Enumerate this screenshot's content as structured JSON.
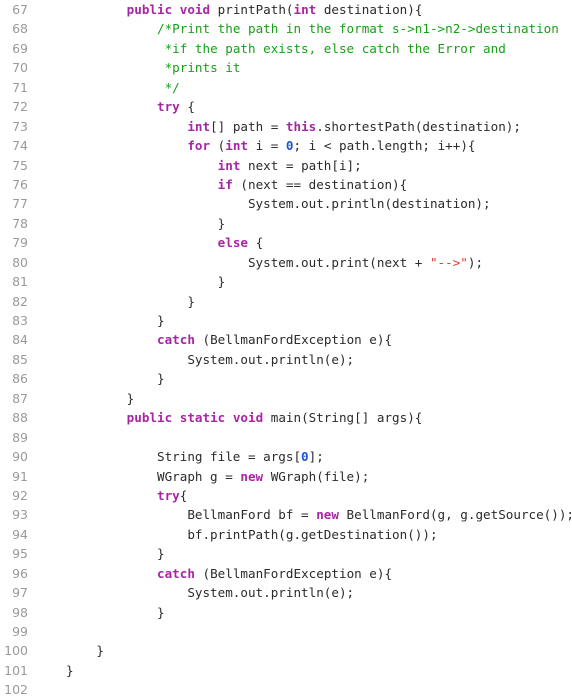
{
  "editor": {
    "language": "Java",
    "first_line_number": 67,
    "last_line_number": 102,
    "colors": {
      "background": "#ffffff",
      "text": "#2b2b2b",
      "gutter": "#9a9a9a",
      "keyword": "#a626a4",
      "comment": "#17a117",
      "string": "#e03c32",
      "number": "#1a54d8"
    }
  },
  "lines": [
    {
      "num": "67",
      "tokens": [
        {
          "t": "        ",
          "c": "pln"
        },
        {
          "t": "public void ",
          "c": "kw"
        },
        {
          "t": "printPath(",
          "c": "pln"
        },
        {
          "t": "int",
          "c": "kw"
        },
        {
          "t": " destination){",
          "c": "pln"
        }
      ]
    },
    {
      "num": "68",
      "tokens": [
        {
          "t": "            ",
          "c": "pln"
        },
        {
          "t": "/*Print the path in the format s->n1->n2->destination",
          "c": "com"
        }
      ]
    },
    {
      "num": "69",
      "tokens": [
        {
          "t": "             ",
          "c": "pln"
        },
        {
          "t": "*if the path exists, else catch the Error and",
          "c": "com"
        }
      ]
    },
    {
      "num": "70",
      "tokens": [
        {
          "t": "             ",
          "c": "pln"
        },
        {
          "t": "*prints it",
          "c": "com"
        }
      ]
    },
    {
      "num": "71",
      "tokens": [
        {
          "t": "             ",
          "c": "pln"
        },
        {
          "t": "*/",
          "c": "com"
        }
      ]
    },
    {
      "num": "72",
      "tokens": [
        {
          "t": "            ",
          "c": "pln"
        },
        {
          "t": "try",
          "c": "kw"
        },
        {
          "t": " {",
          "c": "pln"
        }
      ]
    },
    {
      "num": "73",
      "tokens": [
        {
          "t": "                ",
          "c": "pln"
        },
        {
          "t": "int",
          "c": "kw"
        },
        {
          "t": "[] path = ",
          "c": "pln"
        },
        {
          "t": "this",
          "c": "kw"
        },
        {
          "t": ".shortestPath(destination);",
          "c": "pln"
        }
      ]
    },
    {
      "num": "74",
      "tokens": [
        {
          "t": "                ",
          "c": "pln"
        },
        {
          "t": "for",
          "c": "kw"
        },
        {
          "t": " (",
          "c": "pln"
        },
        {
          "t": "int",
          "c": "kw"
        },
        {
          "t": " i = ",
          "c": "pln"
        },
        {
          "t": "0",
          "c": "num"
        },
        {
          "t": "; i < path.length; i++){",
          "c": "pln"
        }
      ]
    },
    {
      "num": "75",
      "tokens": [
        {
          "t": "                    ",
          "c": "pln"
        },
        {
          "t": "int",
          "c": "kw"
        },
        {
          "t": " next = path[i];",
          "c": "pln"
        }
      ]
    },
    {
      "num": "76",
      "tokens": [
        {
          "t": "                    ",
          "c": "pln"
        },
        {
          "t": "if",
          "c": "kw"
        },
        {
          "t": " (next == destination){",
          "c": "pln"
        }
      ]
    },
    {
      "num": "77",
      "tokens": [
        {
          "t": "                        System.out.println(destination);",
          "c": "pln"
        }
      ]
    },
    {
      "num": "78",
      "tokens": [
        {
          "t": "                    }",
          "c": "pln"
        }
      ]
    },
    {
      "num": "79",
      "tokens": [
        {
          "t": "                    ",
          "c": "pln"
        },
        {
          "t": "else",
          "c": "kw"
        },
        {
          "t": " {",
          "c": "pln"
        }
      ]
    },
    {
      "num": "80",
      "tokens": [
        {
          "t": "                        System.out.print(next + ",
          "c": "pln"
        },
        {
          "t": "\"-->\"",
          "c": "str"
        },
        {
          "t": ");",
          "c": "pln"
        }
      ]
    },
    {
      "num": "81",
      "tokens": [
        {
          "t": "                    }",
          "c": "pln"
        }
      ]
    },
    {
      "num": "82",
      "tokens": [
        {
          "t": "                }",
          "c": "pln"
        }
      ]
    },
    {
      "num": "83",
      "tokens": [
        {
          "t": "            }",
          "c": "pln"
        }
      ]
    },
    {
      "num": "84",
      "tokens": [
        {
          "t": "            ",
          "c": "pln"
        },
        {
          "t": "catch",
          "c": "kw"
        },
        {
          "t": " (BellmanFordException e){",
          "c": "pln"
        }
      ]
    },
    {
      "num": "85",
      "tokens": [
        {
          "t": "                System.out.println(e);",
          "c": "pln"
        }
      ]
    },
    {
      "num": "86",
      "tokens": [
        {
          "t": "            }",
          "c": "pln"
        }
      ]
    },
    {
      "num": "87",
      "tokens": [
        {
          "t": "        }",
          "c": "pln"
        }
      ]
    },
    {
      "num": "88",
      "tokens": [
        {
          "t": "        ",
          "c": "pln"
        },
        {
          "t": "public static void ",
          "c": "kw"
        },
        {
          "t": "main(String[] args){",
          "c": "pln"
        }
      ]
    },
    {
      "num": "89",
      "tokens": [
        {
          "t": "",
          "c": "pln"
        }
      ]
    },
    {
      "num": "90",
      "tokens": [
        {
          "t": "            String file = args[",
          "c": "pln"
        },
        {
          "t": "0",
          "c": "num"
        },
        {
          "t": "];",
          "c": "pln"
        }
      ]
    },
    {
      "num": "91",
      "tokens": [
        {
          "t": "            WGraph g = ",
          "c": "pln"
        },
        {
          "t": "new",
          "c": "kw"
        },
        {
          "t": " WGraph(file);",
          "c": "pln"
        }
      ]
    },
    {
      "num": "92",
      "tokens": [
        {
          "t": "            ",
          "c": "pln"
        },
        {
          "t": "try",
          "c": "kw"
        },
        {
          "t": "{",
          "c": "pln"
        }
      ]
    },
    {
      "num": "93",
      "tokens": [
        {
          "t": "                BellmanFord bf = ",
          "c": "pln"
        },
        {
          "t": "new",
          "c": "kw"
        },
        {
          "t": " BellmanFord(g, g.getSource());",
          "c": "pln"
        }
      ]
    },
    {
      "num": "94",
      "tokens": [
        {
          "t": "                bf.printPath(g.getDestination());",
          "c": "pln"
        }
      ]
    },
    {
      "num": "95",
      "tokens": [
        {
          "t": "            }",
          "c": "pln"
        }
      ]
    },
    {
      "num": "96",
      "tokens": [
        {
          "t": "            ",
          "c": "pln"
        },
        {
          "t": "catch",
          "c": "kw"
        },
        {
          "t": " (BellmanFordException e){",
          "c": "pln"
        }
      ]
    },
    {
      "num": "97",
      "tokens": [
        {
          "t": "                System.out.println(e);",
          "c": "pln"
        }
      ]
    },
    {
      "num": "98",
      "tokens": [
        {
          "t": "            }",
          "c": "pln"
        }
      ]
    },
    {
      "num": "99",
      "tokens": [
        {
          "t": "",
          "c": "pln"
        }
      ]
    },
    {
      "num": "100",
      "tokens": [
        {
          "t": "    }",
          "c": "pln"
        }
      ]
    },
    {
      "num": "101",
      "tokens": [
        {
          "t": "}",
          "c": "pln"
        }
      ]
    },
    {
      "num": "102",
      "tokens": [
        {
          "t": "",
          "c": "pln"
        }
      ]
    }
  ]
}
